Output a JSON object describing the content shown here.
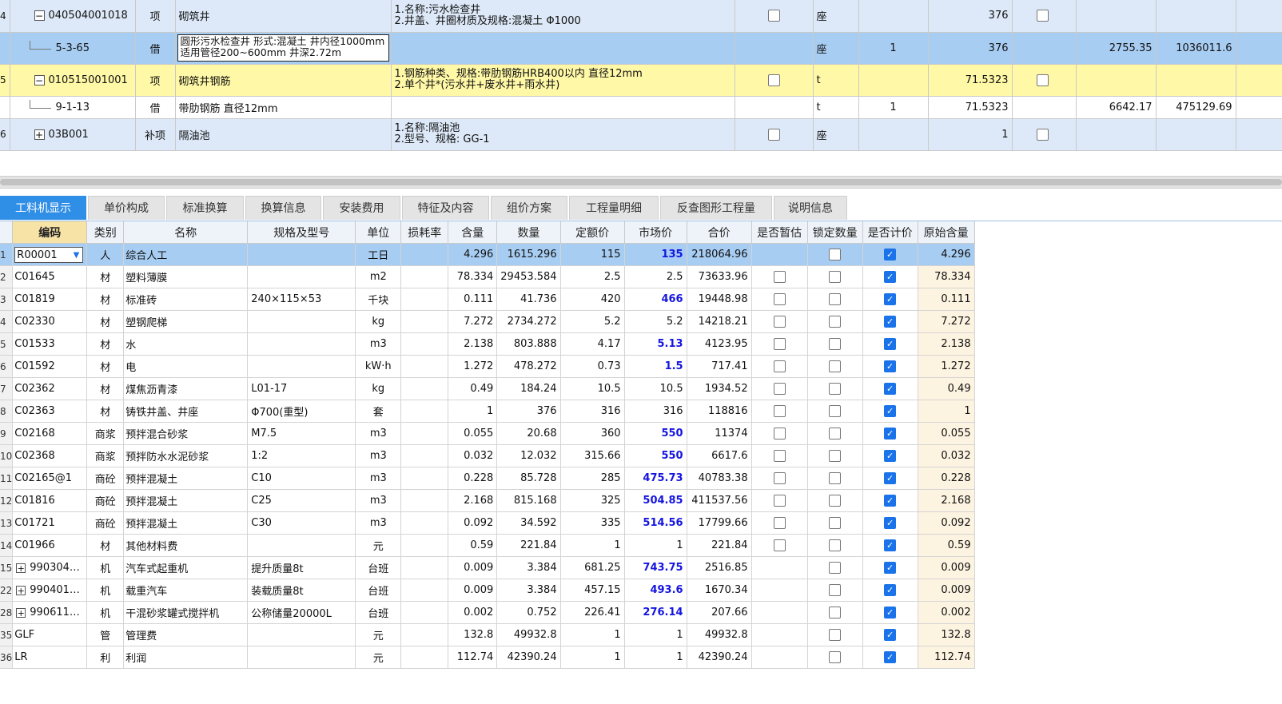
{
  "top_rows": [
    {
      "num": "4",
      "expand": "−",
      "code": "040504001018",
      "type": "项",
      "name": "砌筑井",
      "desc": [
        "1.名称:污水检查井",
        "2.井盖、井圈材质及规格:混凝土 Φ1000"
      ],
      "est": false,
      "unit": "座",
      "coef": "",
      "qty": "376",
      "locked": false,
      "price": "",
      "total": "",
      "style": "blue"
    },
    {
      "num": "",
      "expand": "",
      "code": "5-3-65",
      "type": "借",
      "name": "圆形污水检查井 形式:混凝土 井内径1000mm 适用管径200~600mm 井深2.72m",
      "desc": [],
      "est": null,
      "unit": "座",
      "coef": "1",
      "qty": "376",
      "locked": null,
      "price": "2755.35",
      "total": "1036011.6",
      "style": "sel"
    },
    {
      "num": "5",
      "expand": "−",
      "code": "010515001001",
      "type": "项",
      "name": "砌筑井钢筋",
      "desc": [
        "1.钢筋种类、规格:带肋钢筋HRB400以内 直径12mm",
        "2.单个井*(污水井+废水井+雨水井)"
      ],
      "est": false,
      "unit": "t",
      "coef": "",
      "qty": "71.5323",
      "locked": false,
      "price": "",
      "total": "",
      "style": "yel"
    },
    {
      "num": "",
      "expand": "",
      "code": "9-1-13",
      "type": "借",
      "name": "带肋钢筋 直径12mm",
      "desc": [],
      "est": null,
      "unit": "t",
      "coef": "1",
      "qty": "71.5323",
      "locked": null,
      "price": "6642.17",
      "total": "475129.69",
      "style": "white"
    },
    {
      "num": "6",
      "expand": "+",
      "code": "03B001",
      "type": "补项",
      "name": "隔油池",
      "desc": [
        "1.名称:隔油池",
        "2.型号、规格: GG-1"
      ],
      "est": false,
      "unit": "座",
      "coef": "",
      "qty": "1",
      "locked": false,
      "price": "",
      "total": "",
      "style": "blue"
    }
  ],
  "tabs": [
    "工料机显示",
    "单价构成",
    "标准换算",
    "换算信息",
    "安装费用",
    "特征及内容",
    "组价方案",
    "工程量明细",
    "反查图形工程量",
    "说明信息"
  ],
  "columns": [
    "编码",
    "类别",
    "名称",
    "规格及型号",
    "单位",
    "损耗率",
    "含量",
    "数量",
    "定额价",
    "市场价",
    "合价",
    "是否暂估",
    "锁定数量",
    "是否计价",
    "原始含量"
  ],
  "rows": [
    {
      "n": "1",
      "code": "R00001",
      "cat": "人",
      "name": "综合人工",
      "spec": "",
      "unit": "工日",
      "loss": "",
      "content": "4.296",
      "qty": "1615.296",
      "base": "115",
      "market": "135",
      "mhi": true,
      "total": "218064.96",
      "est": null,
      "lock": false,
      "calc": true,
      "orig": "4.296",
      "expand": false,
      "edit": true
    },
    {
      "n": "2",
      "code": "C01645",
      "cat": "材",
      "name": "塑料薄膜",
      "spec": "",
      "unit": "m2",
      "loss": "",
      "content": "78.334",
      "qty": "29453.584",
      "base": "2.5",
      "market": "2.5",
      "mhi": false,
      "total": "73633.96",
      "est": false,
      "lock": false,
      "calc": true,
      "orig": "78.334",
      "expand": false,
      "edit": false
    },
    {
      "n": "3",
      "code": "C01819",
      "cat": "材",
      "name": "标准砖",
      "spec": "240×115×53",
      "unit": "千块",
      "loss": "",
      "content": "0.111",
      "qty": "41.736",
      "base": "420",
      "market": "466",
      "mhi": true,
      "total": "19448.98",
      "est": false,
      "lock": false,
      "calc": true,
      "orig": "0.111",
      "expand": false,
      "edit": false
    },
    {
      "n": "4",
      "code": "C02330",
      "cat": "材",
      "name": "塑钢爬梯",
      "spec": "",
      "unit": "kg",
      "loss": "",
      "content": "7.272",
      "qty": "2734.272",
      "base": "5.2",
      "market": "5.2",
      "mhi": false,
      "total": "14218.21",
      "est": false,
      "lock": false,
      "calc": true,
      "orig": "7.272",
      "expand": false,
      "edit": false
    },
    {
      "n": "5",
      "code": "C01533",
      "cat": "材",
      "name": "水",
      "spec": "",
      "unit": "m3",
      "loss": "",
      "content": "2.138",
      "qty": "803.888",
      "base": "4.17",
      "market": "5.13",
      "mhi": true,
      "total": "4123.95",
      "est": false,
      "lock": false,
      "calc": true,
      "orig": "2.138",
      "expand": false,
      "edit": false
    },
    {
      "n": "6",
      "code": "C01592",
      "cat": "材",
      "name": "电",
      "spec": "",
      "unit": "kW·h",
      "loss": "",
      "content": "1.272",
      "qty": "478.272",
      "base": "0.73",
      "market": "1.5",
      "mhi": true,
      "total": "717.41",
      "est": false,
      "lock": false,
      "calc": true,
      "orig": "1.272",
      "expand": false,
      "edit": false
    },
    {
      "n": "7",
      "code": "C02362",
      "cat": "材",
      "name": "煤焦沥青漆",
      "spec": "L01-17",
      "unit": "kg",
      "loss": "",
      "content": "0.49",
      "qty": "184.24",
      "base": "10.5",
      "market": "10.5",
      "mhi": false,
      "total": "1934.52",
      "est": false,
      "lock": false,
      "calc": true,
      "orig": "0.49",
      "expand": false,
      "edit": false
    },
    {
      "n": "8",
      "code": "C02363",
      "cat": "材",
      "name": "铸铁井盖、井座",
      "spec": "Φ700(重型)",
      "unit": "套",
      "loss": "",
      "content": "1",
      "qty": "376",
      "base": "316",
      "market": "316",
      "mhi": false,
      "total": "118816",
      "est": false,
      "lock": false,
      "calc": true,
      "orig": "1",
      "expand": false,
      "edit": false
    },
    {
      "n": "9",
      "code": "C02168",
      "cat": "商浆",
      "name": "预拌混合砂浆",
      "spec": "M7.5",
      "unit": "m3",
      "loss": "",
      "content": "0.055",
      "qty": "20.68",
      "base": "360",
      "market": "550",
      "mhi": true,
      "total": "11374",
      "est": false,
      "lock": false,
      "calc": true,
      "orig": "0.055",
      "expand": false,
      "edit": false
    },
    {
      "n": "10",
      "code": "C02368",
      "cat": "商浆",
      "name": "预拌防水水泥砂浆",
      "spec": "1:2",
      "unit": "m3",
      "loss": "",
      "content": "0.032",
      "qty": "12.032",
      "base": "315.66",
      "market": "550",
      "mhi": true,
      "total": "6617.6",
      "est": false,
      "lock": false,
      "calc": true,
      "orig": "0.032",
      "expand": false,
      "edit": false
    },
    {
      "n": "11",
      "code": "C02165@1",
      "cat": "商砼",
      "name": "预拌混凝土",
      "spec": "C10",
      "unit": "m3",
      "loss": "",
      "content": "0.228",
      "qty": "85.728",
      "base": "285",
      "market": "475.73",
      "mhi": true,
      "total": "40783.38",
      "est": false,
      "lock": false,
      "calc": true,
      "orig": "0.228",
      "expand": false,
      "edit": false
    },
    {
      "n": "12",
      "code": "C01816",
      "cat": "商砼",
      "name": "预拌混凝土",
      "spec": "C25",
      "unit": "m3",
      "loss": "",
      "content": "2.168",
      "qty": "815.168",
      "base": "325",
      "market": "504.85",
      "mhi": true,
      "total": "411537.56",
      "est": false,
      "lock": false,
      "calc": true,
      "orig": "2.168",
      "expand": false,
      "edit": false
    },
    {
      "n": "13",
      "code": "C01721",
      "cat": "商砼",
      "name": "预拌混凝土",
      "spec": "C30",
      "unit": "m3",
      "loss": "",
      "content": "0.092",
      "qty": "34.592",
      "base": "335",
      "market": "514.56",
      "mhi": true,
      "total": "17799.66",
      "est": false,
      "lock": false,
      "calc": true,
      "orig": "0.092",
      "expand": false,
      "edit": false
    },
    {
      "n": "14",
      "code": "C01966",
      "cat": "材",
      "name": "其他材料费",
      "spec": "",
      "unit": "元",
      "loss": "",
      "content": "0.59",
      "qty": "221.84",
      "base": "1",
      "market": "1",
      "mhi": false,
      "total": "221.84",
      "est": false,
      "lock": false,
      "calc": true,
      "orig": "0.59",
      "expand": false,
      "edit": false
    },
    {
      "n": "15",
      "code": "990304…",
      "cat": "机",
      "name": "汽车式起重机",
      "spec": "提升质量8t",
      "unit": "台班",
      "loss": "",
      "content": "0.009",
      "qty": "3.384",
      "base": "681.25",
      "market": "743.75",
      "mhi": true,
      "total": "2516.85",
      "est": null,
      "lock": false,
      "calc": true,
      "orig": "0.009",
      "expand": true,
      "edit": false
    },
    {
      "n": "22",
      "code": "990401…",
      "cat": "机",
      "name": "载重汽车",
      "spec": "装载质量8t",
      "unit": "台班",
      "loss": "",
      "content": "0.009",
      "qty": "3.384",
      "base": "457.15",
      "market": "493.6",
      "mhi": true,
      "total": "1670.34",
      "est": null,
      "lock": false,
      "calc": true,
      "orig": "0.009",
      "expand": true,
      "edit": false
    },
    {
      "n": "28",
      "code": "990611…",
      "cat": "机",
      "name": "干混砂浆罐式搅拌机",
      "spec": "公称储量20000L",
      "unit": "台班",
      "loss": "",
      "content": "0.002",
      "qty": "0.752",
      "base": "226.41",
      "market": "276.14",
      "mhi": true,
      "total": "207.66",
      "est": null,
      "lock": false,
      "calc": true,
      "orig": "0.002",
      "expand": true,
      "edit": false
    },
    {
      "n": "35",
      "code": "GLF",
      "cat": "管",
      "name": "管理费",
      "spec": "",
      "unit": "元",
      "loss": "",
      "content": "132.8",
      "qty": "49932.8",
      "base": "1",
      "market": "1",
      "mhi": false,
      "total": "49932.8",
      "est": null,
      "lock": false,
      "calc": true,
      "orig": "132.8",
      "expand": false,
      "edit": false
    },
    {
      "n": "36",
      "code": "LR",
      "cat": "利",
      "name": "利润",
      "spec": "",
      "unit": "元",
      "loss": "",
      "content": "112.74",
      "qty": "42390.24",
      "base": "1",
      "market": "1",
      "mhi": false,
      "total": "42390.24",
      "est": null,
      "lock": false,
      "calc": true,
      "orig": "112.74",
      "expand": false,
      "edit": false
    }
  ],
  "colors": {
    "accent": "#2f8ee6",
    "selected": "#a8cdf3",
    "yellow_row": "#fff8a6",
    "blue_row": "#dde9f8",
    "market_hi": "#1515e0"
  }
}
